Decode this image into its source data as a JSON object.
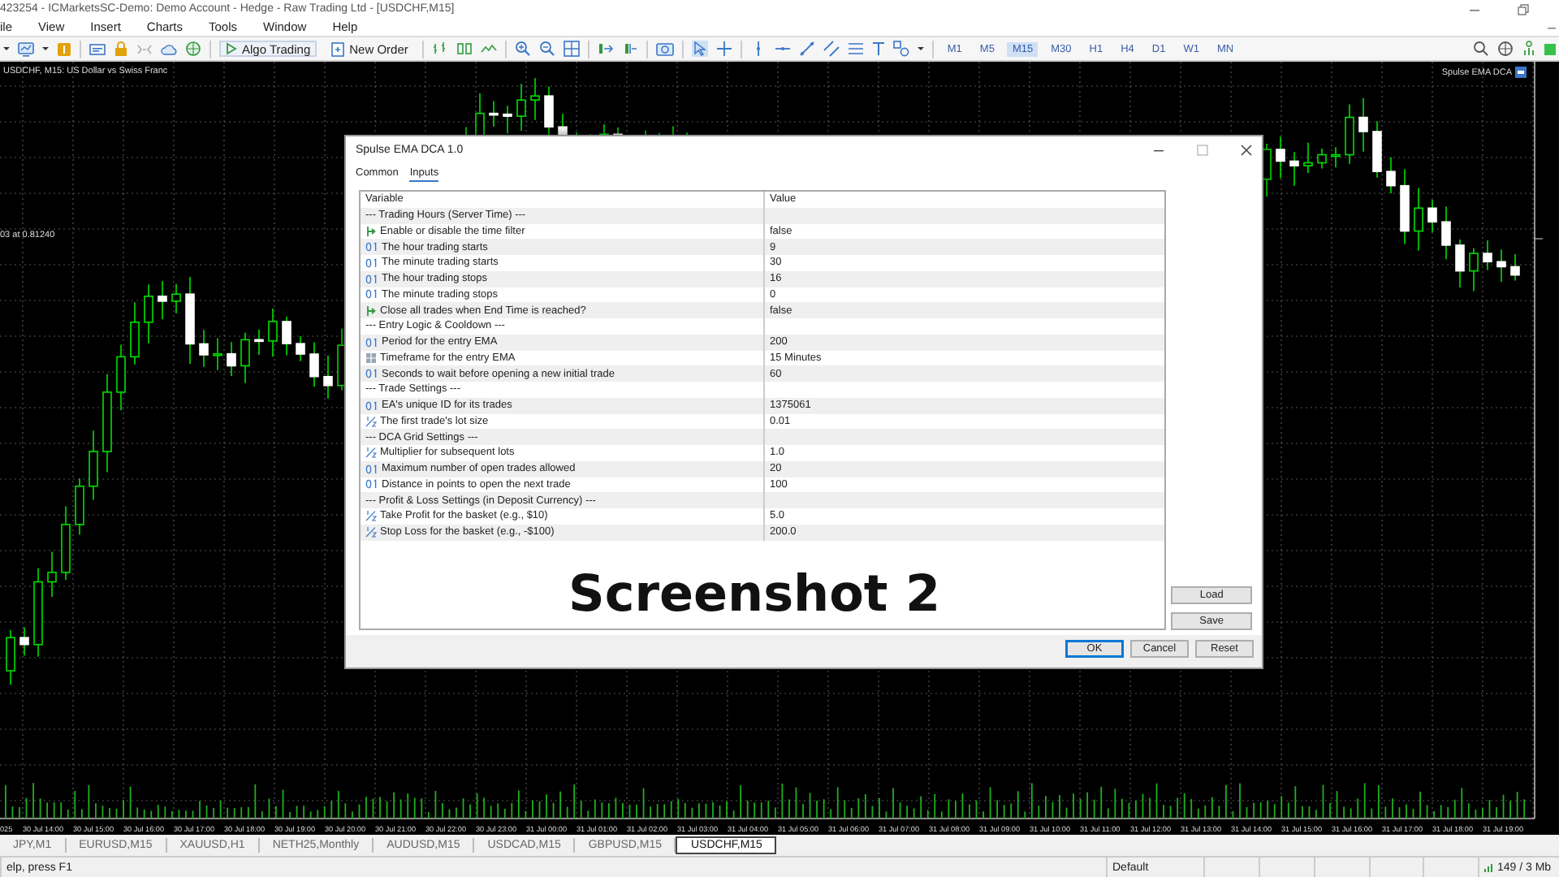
{
  "window": {
    "title": "423254 - ICMarketsSC-Demo: Demo Account - Hedge - Raw Trading Ltd - [USDCHF,M15]"
  },
  "menu": [
    "ile",
    "View",
    "Insert",
    "Charts",
    "Tools",
    "Window",
    "Help"
  ],
  "toolbar": {
    "buttons": [
      {
        "kind": "algo",
        "label": "Algo Trading"
      },
      {
        "kind": "order",
        "label": "New Order"
      }
    ],
    "timeframes": [
      {
        "label": "M1",
        "selected": false
      },
      {
        "label": "M5",
        "selected": false
      },
      {
        "label": "M15",
        "selected": true
      },
      {
        "label": "M30",
        "selected": false
      },
      {
        "label": "H1",
        "selected": false
      },
      {
        "label": "H4",
        "selected": false
      },
      {
        "label": "D1",
        "selected": false
      },
      {
        "label": "W1",
        "selected": false
      },
      {
        "label": "MN",
        "selected": false
      }
    ]
  },
  "chart": {
    "symbol": "USDCHF, M15:  US Dollar vs Swiss Franc",
    "expert": "Spulse EMA DCA",
    "price_note": "03 at 0.81240",
    "time_labels": [
      "025",
      "30 Jul 14:00",
      "30 Jul 15:00",
      "30 Jul 16:00",
      "30 Jul 17:00",
      "30 Jul 18:00",
      "30 Jul 19:00",
      "30 Jul 20:00",
      "30 Jul 21:00",
      "30 Jul 22:00",
      "30 Jul 23:00",
      "31 Jul 00:00",
      "31 Jul 01:00",
      "31 Jul 02:00",
      "31 Jul 03:00",
      "31 Jul 04:00",
      "31 Jul 05:00",
      "31 Jul 06:00",
      "31 Jul 07:00",
      "31 Jul 08:00",
      "31 Jul 09:00",
      "31 Jul 10:00",
      "31 Jul 11:00",
      "31 Jul 12:00",
      "31 Jul 13:00",
      "31 Jul 14:00",
      "31 Jul 15:00",
      "31 Jul 16:00",
      "31 Jul 17:00",
      "31 Jul 18:00",
      "31 Jul 19:00"
    ]
  },
  "dialog": {
    "title": "Spulse EMA DCA 1.0",
    "tabs": [
      {
        "label": "Common",
        "selected": false
      },
      {
        "label": "Inputs",
        "selected": true
      }
    ],
    "columns": [
      "Variable",
      "Value"
    ],
    "rows": [
      {
        "kind": "group",
        "variable": "--- Trading Hours (Server Time) ---"
      },
      {
        "kind": "bool",
        "variable": "Enable or disable the time filter",
        "value": "false"
      },
      {
        "kind": "int",
        "variable": "The hour trading starts",
        "value": "9"
      },
      {
        "kind": "int",
        "variable": "The minute trading starts",
        "value": "30"
      },
      {
        "kind": "int",
        "variable": "The hour trading stops",
        "value": "16"
      },
      {
        "kind": "int",
        "variable": "The minute trading stops",
        "value": "0"
      },
      {
        "kind": "bool",
        "variable": "Close all trades when End Time is reached?",
        "value": "false"
      },
      {
        "kind": "group",
        "variable": "--- Entry Logic & Cooldown ---"
      },
      {
        "kind": "int",
        "variable": "Period for the entry EMA",
        "value": "200"
      },
      {
        "kind": "enum",
        "variable": "Timeframe for the entry EMA",
        "value": "15 Minutes"
      },
      {
        "kind": "int",
        "variable": "Seconds to wait before opening a new initial trade",
        "value": "60"
      },
      {
        "kind": "group",
        "variable": "--- Trade Settings ---"
      },
      {
        "kind": "int",
        "variable": "EA's unique ID for its trades",
        "value": "1375061"
      },
      {
        "kind": "double",
        "variable": "The first trade's lot size",
        "value": "0.01"
      },
      {
        "kind": "group",
        "variable": "--- DCA Grid Settings ---"
      },
      {
        "kind": "double",
        "variable": "Multiplier for subsequent lots",
        "value": "1.0"
      },
      {
        "kind": "int",
        "variable": "Maximum number of open trades allowed",
        "value": "20"
      },
      {
        "kind": "int",
        "variable": "Distance in points to open the next trade",
        "value": "100"
      },
      {
        "kind": "group",
        "variable": "--- Profit & Loss Settings (in Deposit Currency) ---"
      },
      {
        "kind": "double",
        "variable": "Take Profit for the basket (e.g., $10)",
        "value": "5.0"
      },
      {
        "kind": "double",
        "variable": "Stop Loss for the basket (e.g., -$100)",
        "value": "200.0"
      }
    ],
    "side_buttons": [
      "Load",
      "Save"
    ],
    "buttons": [
      {
        "label": "OK",
        "default": true
      },
      {
        "label": "Cancel",
        "default": false
      },
      {
        "label": "Reset",
        "default": false
      }
    ]
  },
  "caption": "Screenshot 2",
  "symbol_tabs": [
    {
      "label": "JPY,M1",
      "selected": false
    },
    {
      "label": "EURUSD,M15",
      "selected": false
    },
    {
      "label": "XAUUSD,H1",
      "selected": false
    },
    {
      "label": "NETH25,Monthly",
      "selected": false
    },
    {
      "label": "AUDUSD,M15",
      "selected": false
    },
    {
      "label": "USDCAD,M15",
      "selected": false
    },
    {
      "label": "GBPUSD,M15",
      "selected": false
    },
    {
      "label": "USDCHF,M15",
      "selected": true
    }
  ],
  "status_bar": {
    "help": "elp, press F1",
    "profile": "Default",
    "traffic": "149 / 3 Mb"
  }
}
